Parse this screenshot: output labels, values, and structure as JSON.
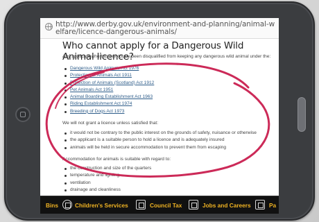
{
  "browser": {
    "url": "http://www.derby.gov.uk/environment-and-planning/animal-welfare/licence-dangerous-animals/"
  },
  "page": {
    "heading": "Who cannot apply for a Dangerous Wild Animal licence?",
    "intro": "Any applicant who has previously been disqualified from keeping any dangerous wild animal under the:",
    "acts": [
      "Dangerous Wild Animals Act 1976",
      "Protection of Animals Act 1911",
      "Protection of Animals (Scotland) Act 1912",
      "Pet Animals Act 1951",
      "Animal Boarding Establishment Act 1963",
      "Riding Establishment Act 1974",
      "Breeding of Dogs Act 1973"
    ],
    "licence_lead": "We will not grant a licence unless satisfied that:",
    "conditions": [
      "it would not be contrary to the public interest on the grounds of safety, nuisance or otherwise",
      "the applicant is a suitable person to hold a licence and is adequately insured",
      "animals will be held in secure accommodation to prevent them from escaping"
    ],
    "accommodation_lead": "Accommodation for animals is suitable with regard to:",
    "regard": [
      "the construction and size of the quarters",
      "temperature and lighting",
      "ventilation",
      "drainage and cleanliness"
    ]
  },
  "footer_nav": {
    "items": [
      "Bins",
      "Children's Services",
      "Council Tax",
      "Jobs and Careers",
      "Pa"
    ]
  },
  "colors": {
    "annotation": "#c8184a",
    "nav_text": "#f0b323",
    "link": "#2e5d8a"
  }
}
